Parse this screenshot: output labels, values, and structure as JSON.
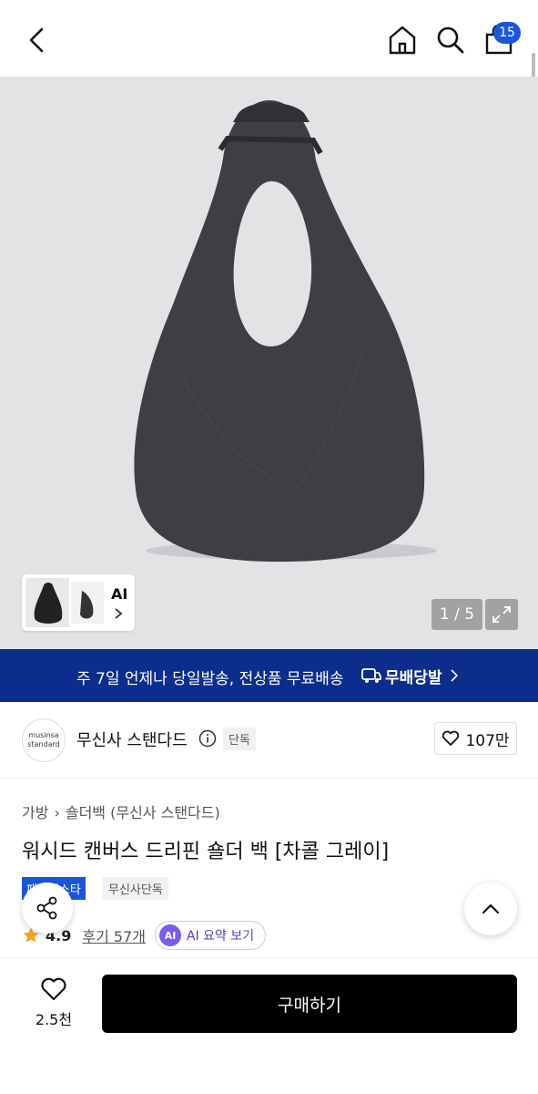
{
  "header": {
    "back_icon": "chevron-left-icon",
    "home_icon": "home-icon",
    "search_icon": "search-icon",
    "cart_icon": "shopping-bag-icon",
    "cart_count": "15"
  },
  "gallery": {
    "ai_label": "AI",
    "counter": "1 / 5",
    "expand_icon": "expand-icon",
    "background_color": "#e2e3e5"
  },
  "promo": {
    "text": "주 7일 언제나 당일발송, 전상품 무료배송",
    "service_name": "무배당발",
    "background_color": "#0d2d8c"
  },
  "brand": {
    "logo_line1": "musinsa",
    "logo_line2": "standard",
    "name": "무신사 스탠다드",
    "tag": "단독",
    "like_count": "107만"
  },
  "product": {
    "breadcrumb": [
      "가방",
      "숄더백 (무신사 스탠다드)"
    ],
    "title": "워시드 캔버스 드리핀 숄더 백 [차콜 그레이]",
    "badges": [
      "패션페스타",
      "무신사단독"
    ],
    "rating": "4.9",
    "reviews": "후기 57개",
    "ai_badge": "AI",
    "ai_summary": "AI 요약 보기"
  },
  "bottom": {
    "wish_count": "2.5천",
    "buy_label": "구매하기"
  },
  "colors": {
    "accent": "#1a56db",
    "buy_button": "#000000",
    "ai_purple": "#7b5cf0",
    "star": "#f5a623"
  }
}
